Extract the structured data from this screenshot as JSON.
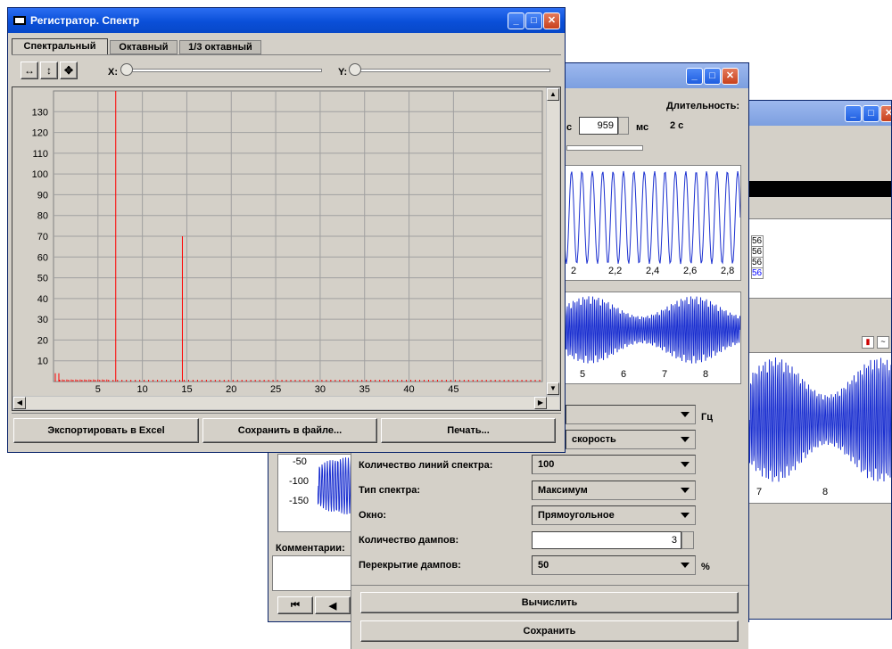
{
  "back_window": {
    "labels": {
      "duration": "Длительность:",
      "duration_value": "2 с",
      "ms_prefix": "с",
      "ms_unit": "мс",
      "ms_value": "959"
    },
    "waveform_ticks": [
      "2",
      "2,2",
      "2,4",
      "2,6",
      "2,8"
    ],
    "overview_ticks": [
      "5",
      "6",
      "7",
      "8"
    ],
    "left_axis": [
      "-50",
      "-100",
      "-150"
    ],
    "left_ticks": [
      "7",
      "8"
    ],
    "cells": [
      "56",
      "56",
      "56",
      "56"
    ],
    "comments_label": "Комментарии:",
    "nav": {
      "first": "⏮",
      "prev": "◀"
    }
  },
  "settings": {
    "freq_unit": "Гц",
    "velocity": "скорость",
    "rows": [
      {
        "label": "Количество линий спектра:",
        "value": "100"
      },
      {
        "label": "Тип спектра:",
        "value": "Максимум"
      },
      {
        "label": "Окно:",
        "value": "Прямоугольное"
      },
      {
        "label": "Количество дампов:",
        "value": "3"
      },
      {
        "label": "Перекрытие дампов:",
        "value": "50"
      }
    ],
    "percent": "%",
    "calc_button": "Вычислить",
    "save_button": "Сохранить"
  },
  "front": {
    "title": "Регистратор. Спектр",
    "tabs": [
      "Спектральный",
      "Октавный",
      "1/3 октавный"
    ],
    "x_label": "X:",
    "y_label": "Y:",
    "export_button": "Экспортировать в Excel",
    "save_file_button": "Сохранить в файле...",
    "print_button": "Печать..."
  },
  "chart_data": {
    "type": "bar",
    "title": "",
    "xlabel": "",
    "ylabel": "",
    "xlim": [
      0,
      55
    ],
    "ylim": [
      0,
      140
    ],
    "x_ticks": [
      5,
      10,
      15,
      20,
      25,
      30,
      35,
      40,
      45
    ],
    "y_ticks": [
      10,
      20,
      30,
      40,
      50,
      60,
      70,
      80,
      90,
      100,
      110,
      120,
      130
    ],
    "series": [
      {
        "x": [
          7,
          14.5,
          0.2,
          0.6,
          1,
          1.5,
          2,
          2.5,
          3,
          3.5,
          4,
          4.5,
          5,
          5.5,
          6
        ],
        "values": [
          140,
          70,
          4,
          4,
          1,
          1,
          1,
          1,
          1,
          1,
          1,
          1,
          1,
          1,
          1
        ]
      }
    ],
    "grid": true,
    "color": "#ff0000"
  }
}
